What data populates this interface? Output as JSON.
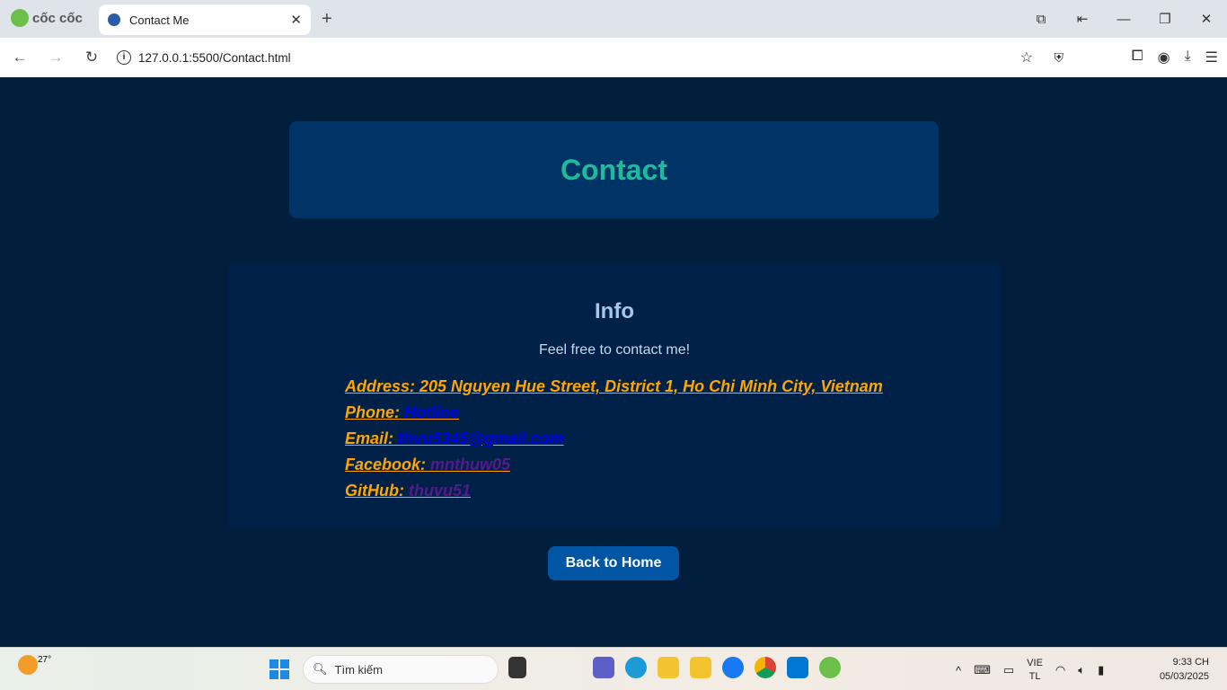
{
  "browser": {
    "brand": "cốc cốc",
    "tab_title": "Contact Me",
    "url": "127.0.0.1:5500/Contact.html"
  },
  "page": {
    "title": "Contact",
    "info_heading": "Info",
    "subtitle": "Feel free to contact me!",
    "items": [
      {
        "label": "Address: 205 Nguyen Hue Street, District 1, Ho Chi Minh City, Vietnam",
        "value": ""
      },
      {
        "label": "Phone: ",
        "value": "Hotline"
      },
      {
        "label": "Email: ",
        "value": "thvu5345@gmail.com"
      },
      {
        "label": "Facebook: ",
        "value": "mnthuw05"
      },
      {
        "label": "GitHub: ",
        "value": "thuvu51"
      }
    ],
    "back_button": "Back to Home"
  },
  "taskbar": {
    "temperature": "27°",
    "search_placeholder": "Tìm kiếm",
    "lang_top": "VIE",
    "lang_bottom": "TL",
    "time": "9:33 CH",
    "date": "05/03/2025"
  },
  "colors": {
    "page_bg": "#011e3d",
    "header_bg": "#003366",
    "title": "#1abc9c",
    "label": "#ffa500",
    "link": "#0000ee",
    "visited": "#551a8b",
    "button": "#0055a5"
  }
}
